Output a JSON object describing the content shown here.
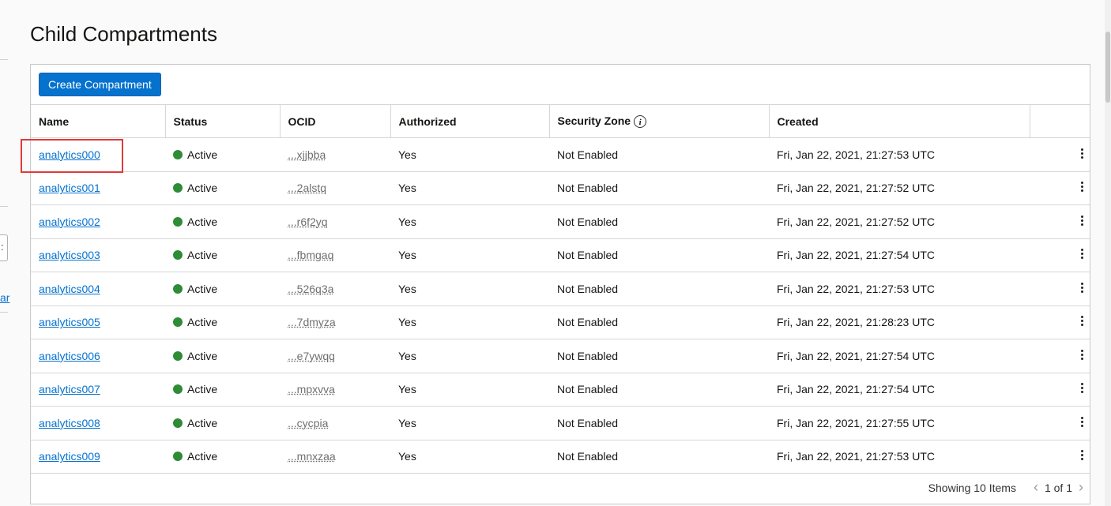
{
  "page": {
    "title": "Child Compartments"
  },
  "leftnav": {
    "link_fragment": "ar",
    "box_glyph": ":"
  },
  "toolbar": {
    "create_label": "Create Compartment"
  },
  "table": {
    "headers": {
      "name": "Name",
      "status": "Status",
      "ocid": "OCID",
      "authorized": "Authorized",
      "security_zone": "Security Zone",
      "created": "Created"
    },
    "rows": [
      {
        "name": "analytics000",
        "status": "Active",
        "ocid": "...xjjbba",
        "authorized": "Yes",
        "security_zone": "Not Enabled",
        "created": "Fri, Jan 22, 2021, 21:27:53 UTC"
      },
      {
        "name": "analytics001",
        "status": "Active",
        "ocid": "...2alstq",
        "authorized": "Yes",
        "security_zone": "Not Enabled",
        "created": "Fri, Jan 22, 2021, 21:27:52 UTC"
      },
      {
        "name": "analytics002",
        "status": "Active",
        "ocid": "...r6f2yq",
        "authorized": "Yes",
        "security_zone": "Not Enabled",
        "created": "Fri, Jan 22, 2021, 21:27:52 UTC"
      },
      {
        "name": "analytics003",
        "status": "Active",
        "ocid": "...fbmgaq",
        "authorized": "Yes",
        "security_zone": "Not Enabled",
        "created": "Fri, Jan 22, 2021, 21:27:54 UTC"
      },
      {
        "name": "analytics004",
        "status": "Active",
        "ocid": "...526q3a",
        "authorized": "Yes",
        "security_zone": "Not Enabled",
        "created": "Fri, Jan 22, 2021, 21:27:53 UTC"
      },
      {
        "name": "analytics005",
        "status": "Active",
        "ocid": "...7dmyza",
        "authorized": "Yes",
        "security_zone": "Not Enabled",
        "created": "Fri, Jan 22, 2021, 21:28:23 UTC"
      },
      {
        "name": "analytics006",
        "status": "Active",
        "ocid": "...e7ywqq",
        "authorized": "Yes",
        "security_zone": "Not Enabled",
        "created": "Fri, Jan 22, 2021, 21:27:54 UTC"
      },
      {
        "name": "analytics007",
        "status": "Active",
        "ocid": "...mpxvva",
        "authorized": "Yes",
        "security_zone": "Not Enabled",
        "created": "Fri, Jan 22, 2021, 21:27:54 UTC"
      },
      {
        "name": "analytics008",
        "status": "Active",
        "ocid": "...cycpia",
        "authorized": "Yes",
        "security_zone": "Not Enabled",
        "created": "Fri, Jan 22, 2021, 21:27:55 UTC"
      },
      {
        "name": "analytics009",
        "status": "Active",
        "ocid": "...mnxzaa",
        "authorized": "Yes",
        "security_zone": "Not Enabled",
        "created": "Fri, Jan 22, 2021, 21:27:53 UTC"
      }
    ]
  },
  "footer": {
    "showing": "Showing 10 Items",
    "page": "1 of 1"
  },
  "colors": {
    "accent": "#0572ce",
    "status_active": "#2e8b36",
    "highlight": "#e03a3a"
  },
  "icons": {
    "info": "info-icon",
    "actions": "kebab-menu-icon",
    "prev": "chevron-left-icon",
    "next": "chevron-right-icon"
  }
}
